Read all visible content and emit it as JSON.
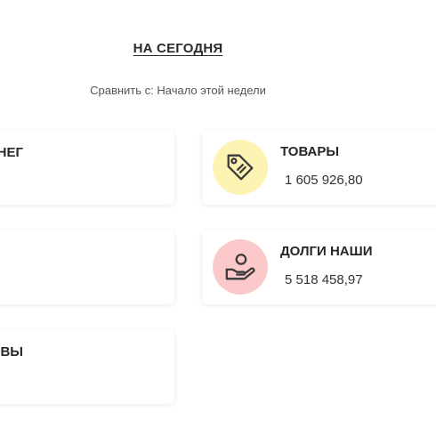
{
  "header": {
    "period_title": "НА СЕГОДНЯ",
    "compare_text": "Сравнить с: Начало этой недели"
  },
  "cards_left": [
    {
      "title": "НЕГ"
    },
    {
      "title": ""
    },
    {
      "title": "ИВЫ"
    }
  ],
  "cards_right": [
    {
      "title": "ТОВАРЫ",
      "value": "1 605 926,80",
      "icon": "price-tag-icon",
      "icon_bg": "#fdf3b3"
    },
    {
      "title": "ДОЛГИ НАШИ",
      "value": "5 518 458,97",
      "icon": "hand-coin-icon",
      "icon_bg": "#fbc9c9"
    }
  ]
}
